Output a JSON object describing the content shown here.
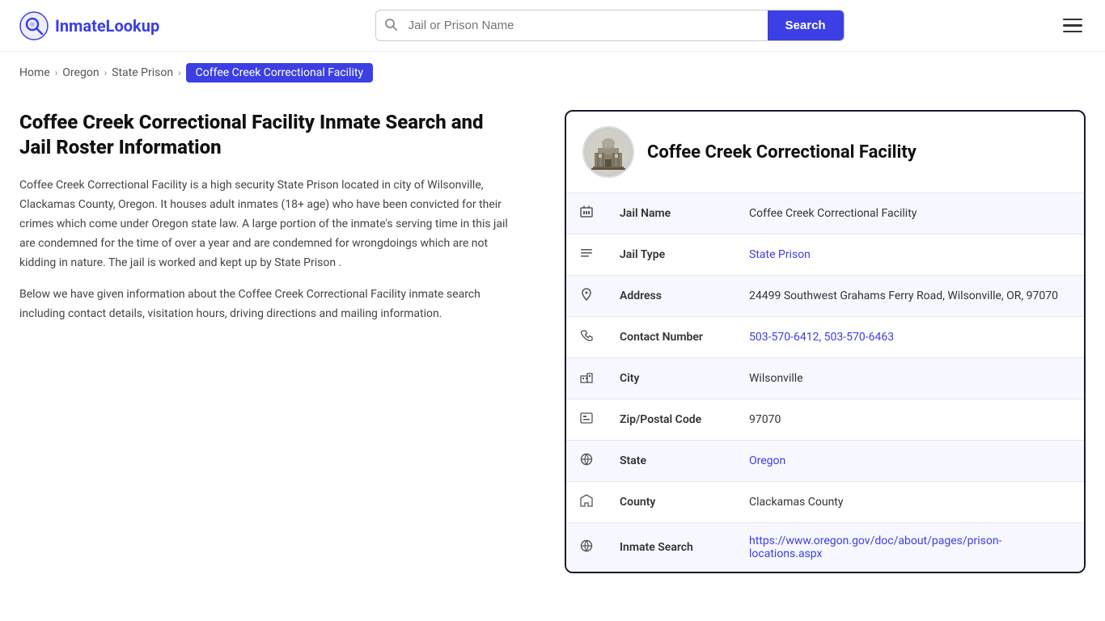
{
  "header": {
    "logo_text": "InmateLookup",
    "search_placeholder": "Jail or Prison Name",
    "search_button_label": "Search"
  },
  "breadcrumb": {
    "home": "Home",
    "oregon": "Oregon",
    "state_prison": "State Prison",
    "active": "Coffee Creek Correctional Facility"
  },
  "left_panel": {
    "heading": "Coffee Creek Correctional Facility Inmate Search and Jail Roster Information",
    "paragraph1": "Coffee Creek Correctional Facility is a high security State Prison located in city of Wilsonville, Clackamas County, Oregon. It houses adult inmates (18+ age) who have been convicted for their crimes which come under Oregon state law. A large portion of the inmate's serving time in this jail are condemned for the time of over a year and are condemned for wrongdoings which are not kidding in nature. The jail is worked and kept up by State Prison .",
    "paragraph2": "Below we have given information about the Coffee Creek Correctional Facility inmate search including contact details, visitation hours, driving directions and mailing information."
  },
  "info_card": {
    "title": "Coffee Creek Correctional Facility",
    "rows": [
      {
        "icon": "jail-icon",
        "label": "Jail Name",
        "value": "Coffee Creek Correctional Facility",
        "type": "text"
      },
      {
        "icon": "list-icon",
        "label": "Jail Type",
        "value": "State Prison",
        "type": "link",
        "href": "#"
      },
      {
        "icon": "location-icon",
        "label": "Address",
        "value": "24499 Southwest Grahams Ferry Road, Wilsonville, OR, 97070",
        "type": "text"
      },
      {
        "icon": "phone-icon",
        "label": "Contact Number",
        "value": "503-570-6412, 503-570-6463",
        "type": "link",
        "href": "tel:5035706412"
      },
      {
        "icon": "city-icon",
        "label": "City",
        "value": "Wilsonville",
        "type": "text"
      },
      {
        "icon": "zip-icon",
        "label": "Zip/Postal Code",
        "value": "97070",
        "type": "text"
      },
      {
        "icon": "globe-icon",
        "label": "State",
        "value": "Oregon",
        "type": "link",
        "href": "#"
      },
      {
        "icon": "county-icon",
        "label": "County",
        "value": "Clackamas County",
        "type": "text"
      },
      {
        "icon": "search-globe-icon",
        "label": "Inmate Search",
        "value": "https://www.oregon.gov/doc/about/pages/prison-locations.aspx",
        "type": "link",
        "href": "https://www.oregon.gov/doc/about/pages/prison-locations.aspx"
      }
    ]
  }
}
